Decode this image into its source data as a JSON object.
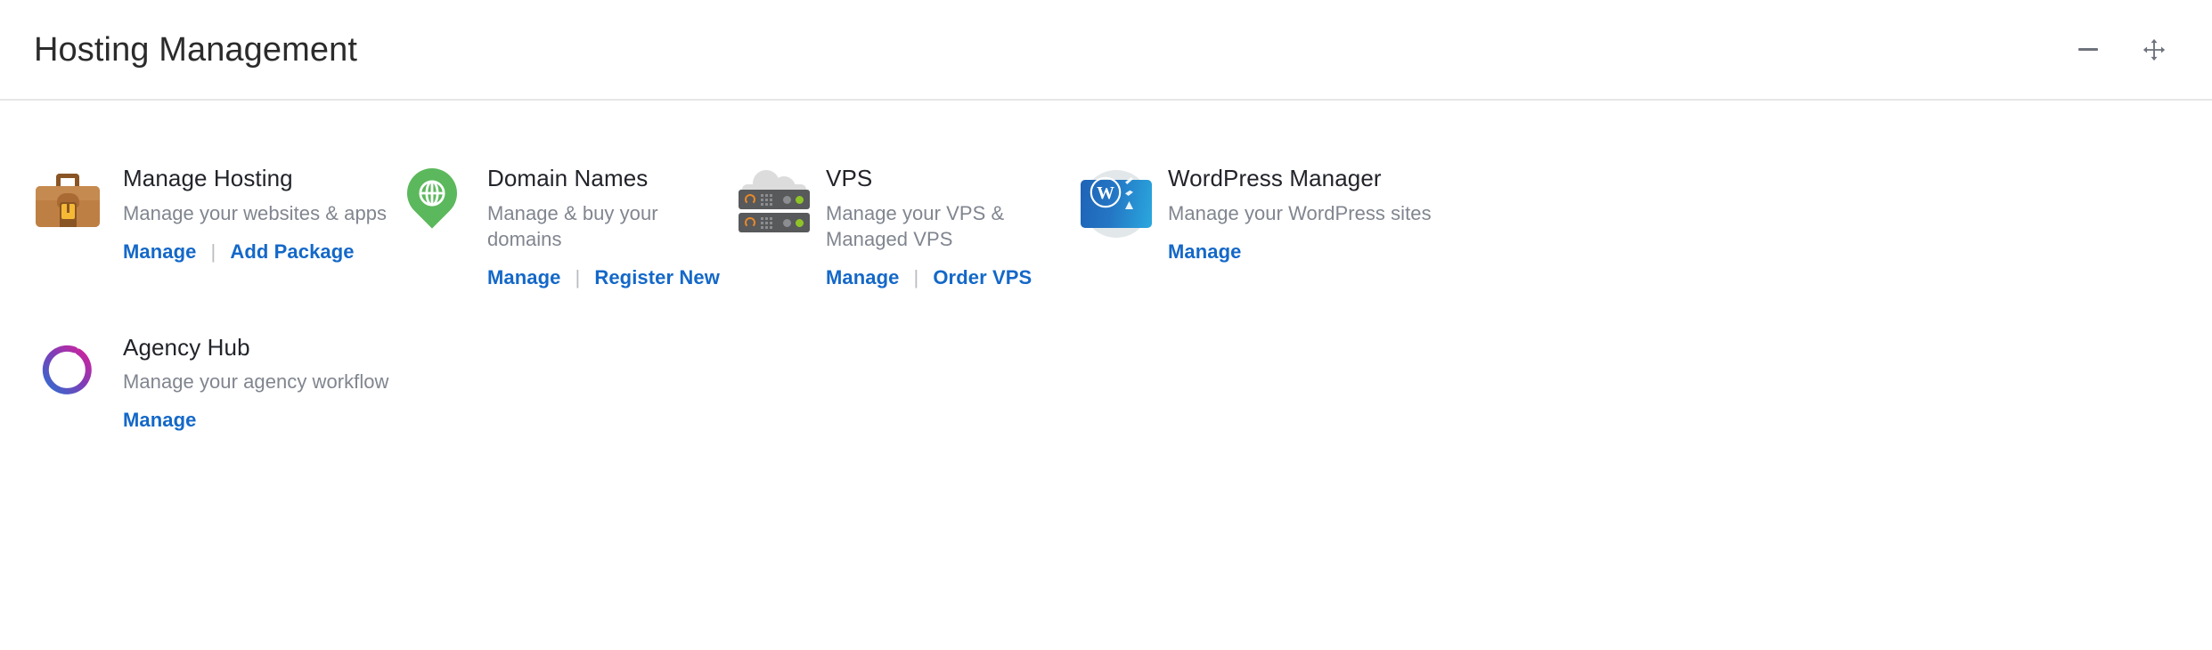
{
  "header": {
    "title": "Hosting Management",
    "minimize_label": "Minimize",
    "move_label": "Move"
  },
  "colors": {
    "link": "#1468c8",
    "title_text": "#22242a",
    "desc_text": "#80858f",
    "separator": "#b9bcc2",
    "panel_bg": "#ffffff",
    "header_border": "#e6e6e6",
    "briefcase_brown": "#bd7f44",
    "pin_green": "#5cb85c",
    "server_gray": "#58595b",
    "led_green": "#8fc429",
    "ring_accent": "#e8892a",
    "wordpress_blue": "#2476c4",
    "agency_gradient_start": "#2f6fd0",
    "agency_gradient_end": "#d6219b"
  },
  "cards": [
    {
      "id": "manage-hosting",
      "icon": "briefcase-icon",
      "title": "Manage Hosting",
      "description": "Manage your websites & apps",
      "links": [
        {
          "label": "Manage"
        },
        {
          "label": "Add Package"
        }
      ],
      "separator": "|"
    },
    {
      "id": "domain-names",
      "icon": "map-pin-globe-icon",
      "title": "Domain Names",
      "description": "Manage & buy your domains",
      "links": [
        {
          "label": "Manage"
        },
        {
          "label": "Register New"
        }
      ],
      "separator": "|"
    },
    {
      "id": "vps",
      "icon": "cloud-server-icon",
      "title": "VPS",
      "description": "Manage your VPS & Managed VPS",
      "links": [
        {
          "label": "Manage"
        },
        {
          "label": "Order VPS"
        }
      ],
      "separator": "|"
    },
    {
      "id": "wordpress-manager",
      "icon": "wordpress-icon",
      "title": "WordPress Manager",
      "description": "Manage your WordPress sites",
      "links": [
        {
          "label": "Manage"
        }
      ],
      "separator": "|"
    },
    {
      "id": "agency-hub",
      "icon": "agency-ring-icon",
      "title": "Agency Hub",
      "description": "Manage your agency workflow",
      "links": [
        {
          "label": "Manage"
        }
      ],
      "separator": "|"
    }
  ]
}
